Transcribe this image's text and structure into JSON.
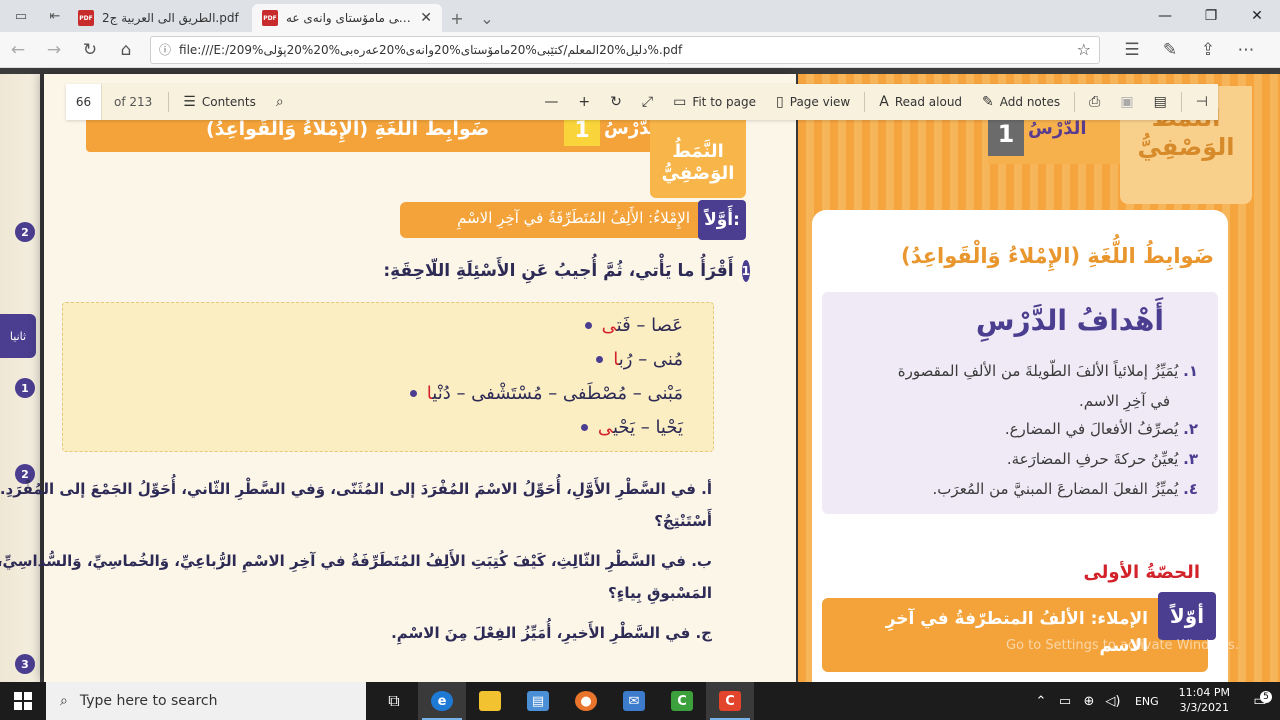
{
  "browser": {
    "tabs": [
      {
        "title": "الطريق الى العربية ج2.pdf",
        "icon": "pdf-icon"
      },
      {
        "title": "کتێبی مامۆستای وانەی عە",
        "icon": "pdf-icon",
        "close": "✕"
      }
    ],
    "url": "file:///E:/209%دليل%20المعلم/کتێبی%20مامۆستای%20وانەی%20عەرەبی%20%20پۆلی%.pdf"
  },
  "pdf_toolbar": {
    "page_number": "66",
    "page_of": "of 213",
    "contents": "Contents",
    "fit_to_page": "Fit to page",
    "page_view": "Page view",
    "read_aloud": "Read aloud",
    "add_notes": "Add notes"
  },
  "left_page": {
    "lesson_label": "الدَّرْسُ",
    "lesson_number": "1",
    "lesson_title": "ضَوابِطُ اللُّغَةِ (الإِمْلاءُ وَالْقَواعِدُ)",
    "style_badge": "النَّمَطُ الوَصْفِيُّ",
    "section_tag": "أَوَّلاً:",
    "section_title": "الإِمْلاءُ: الأَلِفُ المُتَطَرِّفَةُ في آخِرِ الاسْمِ",
    "q1_number": "1",
    "q1_text": "أَقْرَأُ ما يَأْتي، ثُمَّ أُجيبُ عَنِ الأَسْئِلَةِ اللّاحِقَةِ:",
    "words": [
      {
        "plain": "عَصا – فَت",
        "red": "ى"
      },
      {
        "plain": "مُنى – رُب",
        "red": "ا"
      },
      {
        "plain": "مَبْنى – مُصْطَفى – مُسْتَشْفى – دُنْي",
        "red": "ا"
      },
      {
        "plain": "يَحْيا – يَحْي",
        "red": "ى"
      }
    ],
    "questions": [
      "أ.  في السَّطْرِ الأَوَّلِ، أُحَوِّلُ الاسْمَ المُفْرَدَ إلى المُثَنّى، وَفي السَّطْرِ الثّاني، أُحَوِّلُ الجَمْعَ إلى المُفْرَدِ. ماذا",
      "أَسْتَنْتِجُ؟",
      "ب. في السَّطْرِ الثّالِثِ، كَيْفَ كُتِبَتِ الأَلِفُ المُتَطَرِّفَةُ في آخِرِ الاسْمِ الرُّباعِيِّ، وَالخُماسِيِّ، وَالسُّداسِيِّ، غَيْرِ",
      "المَسْبوقِ بِياءٍ؟",
      "ج.  في السَّطْرِ الأَخيرِ، أُمَيِّزُ الفِعْلَ مِنَ الاسْمِ."
    ],
    "sliver_marks": [
      "2",
      "1",
      "2",
      "3"
    ],
    "sliver_tab": "ثانيا"
  },
  "right_page": {
    "lesson_label": "الدَّرْسُ",
    "lesson_number": "1",
    "style_badge": "النَّمَطُ الوَصْفِيُّ",
    "title": "ضَوابِطُ اللُّغَةِ (الإِمْلاءُ وَالْقَواعِدُ)",
    "goals_title": "أَهْدافُ الدَّرْسِ",
    "goals": [
      {
        "num": "١.",
        "text": "يُمَيِّزُ إملائياً الألفَ الطّويلةَ من الألفِ المقصورة"
      },
      {
        "num": "",
        "text": "في آخِرِ الاسم."
      },
      {
        "num": "٢.",
        "text": "يُصرِّفُ الأفعالَ في المضارع."
      },
      {
        "num": "٣.",
        "text": "يُعيِّنُ حركةَ حرفِ المضارَعة."
      },
      {
        "num": "٤.",
        "text": "يُميِّزُ الفعلَ المضارعَ المبنيَّ من المُعرَب."
      }
    ],
    "session": "الحصّةُ الأولى",
    "section_tag": "أوّلاً",
    "section_text": "الإملاء: الألفُ المتطرّفةُ في آخرِ الاسم",
    "watermark": "Go to Settings to activate Windows."
  },
  "taskbar": {
    "search_placeholder": "Type here to search",
    "language": "ENG",
    "time": "11:04 PM",
    "date": "3/3/2021",
    "notifications": "5"
  }
}
